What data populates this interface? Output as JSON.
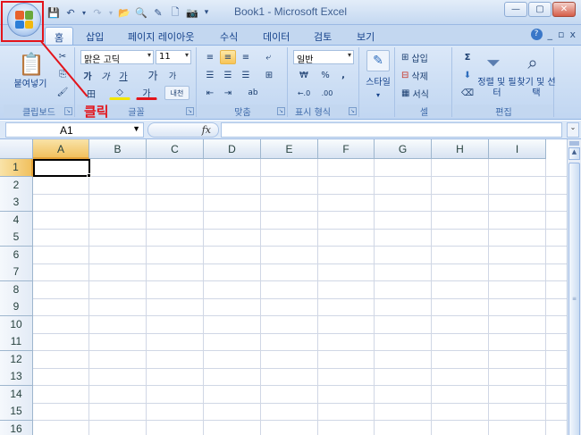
{
  "window": {
    "title": "Book1 - Microsoft Excel",
    "min": "—",
    "max": "▢",
    "close": "✕"
  },
  "qat": {
    "save": "💾",
    "undo": "↶",
    "undo_drop": "▾",
    "redo": "↷",
    "redo_drop": "▾",
    "open": "📂",
    "preview": "🔍",
    "edit": "✎",
    "new": "🗋",
    "camera": "📷",
    "more": "▾"
  },
  "annotation": {
    "label": "클릭",
    "color": "#e3141b"
  },
  "tabs": [
    "홈",
    "삽입",
    "페이지 레이아웃",
    "수식",
    "데이터",
    "검토",
    "보기"
  ],
  "help": {
    "help": "?",
    "min": "_",
    "restore": "▫",
    "close": "x"
  },
  "ribbon": {
    "clipboard": {
      "title": "클립보드",
      "paste": "붙여넣기",
      "cut": "✂",
      "copy": "⎘",
      "format_painter": "🖌"
    },
    "font": {
      "title": "글꼴",
      "name": "맑은 고딕",
      "size": "11",
      "bold": "가",
      "italic": "가",
      "underline": "가",
      "grow": "가",
      "shrink": "가",
      "border": "田",
      "fill": "◇",
      "color": "가",
      "phonetic": "내천"
    },
    "alignment": {
      "title": "맞춤",
      "wrap": "⤶",
      "merge": "⊞",
      "orient": "ab"
    },
    "number": {
      "title": "표시 형식",
      "format": "일반",
      "currency": "₩",
      "percent": "%",
      "comma": ",",
      "inc": "←.0",
      "dec": ".00"
    },
    "styles": {
      "title": "",
      "label": "스타일"
    },
    "cells": {
      "title": "셀",
      "insert": "삽입",
      "delete": "삭제",
      "format": "서식"
    },
    "editing": {
      "title": "편집",
      "sum": "Σ",
      "fill": "⬇",
      "clear": "⌫",
      "sort": "정렬 및 필터",
      "find": "찾기 및 선택"
    }
  },
  "formula_bar": {
    "name_box": "A1",
    "fx": "fx",
    "content": ""
  },
  "grid": {
    "columns": [
      "A",
      "B",
      "C",
      "D",
      "E",
      "F",
      "G",
      "H",
      "I"
    ],
    "rows": [
      "1",
      "2",
      "3",
      "4",
      "5",
      "6",
      "7",
      "8",
      "9",
      "10",
      "11",
      "12",
      "13",
      "14",
      "15",
      "16"
    ],
    "selected_column": "A",
    "selected_row": "1"
  },
  "colors": {
    "accent": "#e3141b",
    "selection": "#f1c15f",
    "ribbon": "#c8dbf3"
  }
}
